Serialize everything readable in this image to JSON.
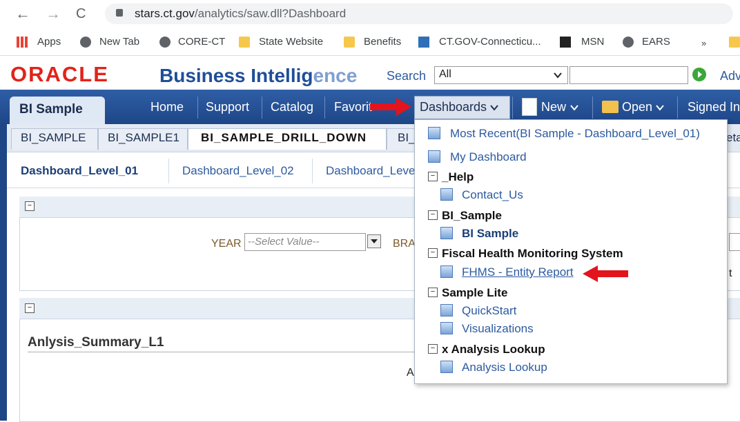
{
  "browser": {
    "back": "←",
    "forward": "→",
    "reload": "C",
    "url_host": "stars.ct.gov",
    "url_path": "/analytics/saw.dll?Dashboard",
    "bookmarks": [
      "Apps",
      "New Tab",
      "CORE-CT",
      "State Website",
      "Benefits",
      "CT.GOV-Connecticu...",
      "MSN",
      "EARS"
    ],
    "more": "»"
  },
  "header": {
    "logo": "ORACLE",
    "title_main": "Business Intellig",
    "title_fade": "ence",
    "search_label": "Search",
    "search_scope": "All",
    "advanced": "Adv"
  },
  "nav": {
    "app_tab": "BI Sample",
    "links": [
      "Home",
      "Support",
      "Catalog",
      "Favorit"
    ],
    "dashboards": "Dashboards",
    "new": "New",
    "open": "Open",
    "signed_in": "Signed In"
  },
  "subtabs": [
    "BI_SAMPLE",
    "BI_SAMPLE1",
    "BI_SAMPLE_DRILL_DOWN",
    "BI_",
    "eta"
  ],
  "page_tabs": [
    "Dashboard_Level_01",
    "Dashboard_Level_02",
    "Dashboard_Leve"
  ],
  "prompts": {
    "year_label": "YEAR",
    "year_placeholder": "--Select Value--",
    "bra_label": "BRA",
    "right_fragment": "t"
  },
  "analysis": {
    "title": "Anlysis_Summary_L1",
    "fragment": "A"
  },
  "menu": {
    "most_recent": "Most Recent(BI Sample - Dashboard_Level_01)",
    "my_dashboard": "My Dashboard",
    "groups": [
      {
        "name": "_Help",
        "items": [
          "Contact_Us"
        ]
      },
      {
        "name": "BI_Sample",
        "items": [
          "BI Sample"
        ]
      },
      {
        "name": "Fiscal Health Monitoring System",
        "items": [
          "FHMS - Entity Report"
        ]
      },
      {
        "name": "Sample Lite",
        "items": [
          "QuickStart",
          "Visualizations"
        ]
      },
      {
        "name": "x Analysis Lookup",
        "items": [
          "Analysis Lookup"
        ]
      }
    ]
  },
  "colors": {
    "oracle_red": "#e2231a",
    "nav_blue": "#1d4687",
    "link_blue": "#2c5aa0",
    "arrow_red": "#e3141c"
  }
}
